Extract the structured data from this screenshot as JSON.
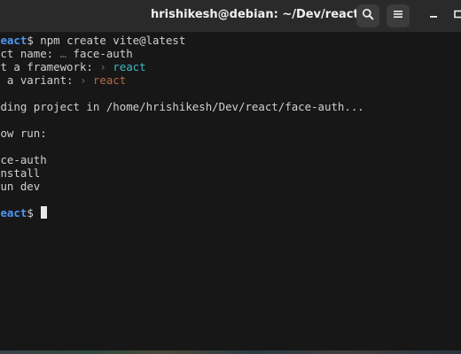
{
  "window": {
    "title": "hrishikesh@debian: ~/Dev/react"
  },
  "toolbar": {
    "search_icon": "search-icon",
    "menu_icon": "hamburger-menu-icon",
    "minimize_icon": "minimize-icon",
    "maximize_icon": "maximize-icon"
  },
  "terminal": {
    "line1": {
      "dir": "react",
      "sym": "$",
      "cmd": " npm create vite@latest"
    },
    "line2": {
      "text": "ect name: ",
      "dim": "… ",
      "value": "face-auth"
    },
    "line3": {
      "text": "ct a framework: ",
      "dim": "› ",
      "value": "react"
    },
    "line4": {
      "text": "t a variant: ",
      "dim": "› ",
      "value": "react"
    },
    "line5": {
      "text": "lding project in /home/hrishikesh/Dev/react/face-auth..."
    },
    "line6": {
      "text": "Now run:"
    },
    "line7": {
      "text": "ace-auth"
    },
    "line8": {
      "text": "install"
    },
    "line9": {
      "text": "run dev"
    },
    "line10": {
      "dir": "react",
      "sym": "$"
    }
  },
  "colors": {
    "background": "#171717",
    "titlebar": "#2a2a2a",
    "prompt_dir": "#4d96f2",
    "framework_value": "#3fb8c4",
    "variant_value": "#b86a47"
  }
}
